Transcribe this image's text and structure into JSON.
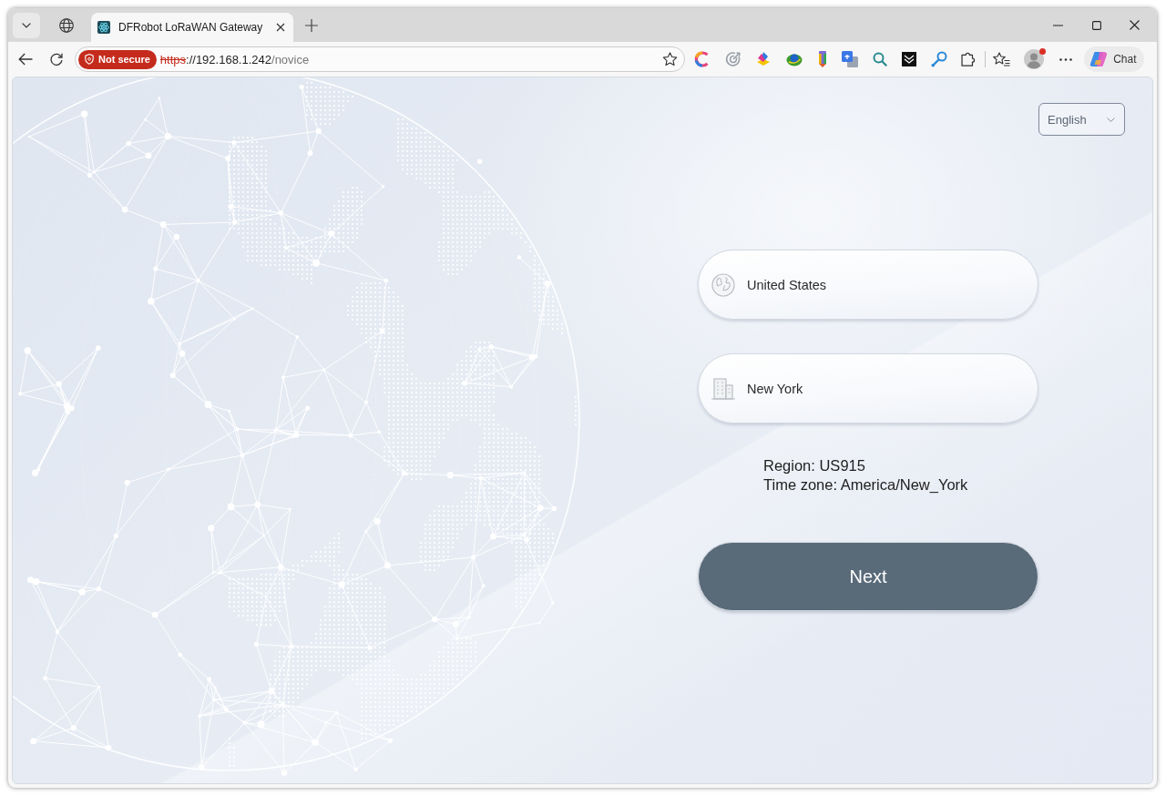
{
  "browser": {
    "tabs": [
      {
        "title": "DFRobot LoRaWAN Gateway",
        "selected": true
      }
    ],
    "address_bar": {
      "insecure": true,
      "security_badge": "Not secure",
      "url_scheme": "https",
      "url_host": "://192.168.1.242",
      "url_path": "/novice"
    },
    "profile": {
      "notification": true
    },
    "chat_button": "Chat"
  },
  "page": {
    "language_select": {
      "value": "English"
    },
    "fields": [
      {
        "kind": "country",
        "value": "United States"
      },
      {
        "kind": "city",
        "value": "New York"
      }
    ],
    "info_lines": [
      "Region: US915",
      "Time zone: America/New_York"
    ],
    "next_button": {
      "label": "Next"
    }
  }
}
